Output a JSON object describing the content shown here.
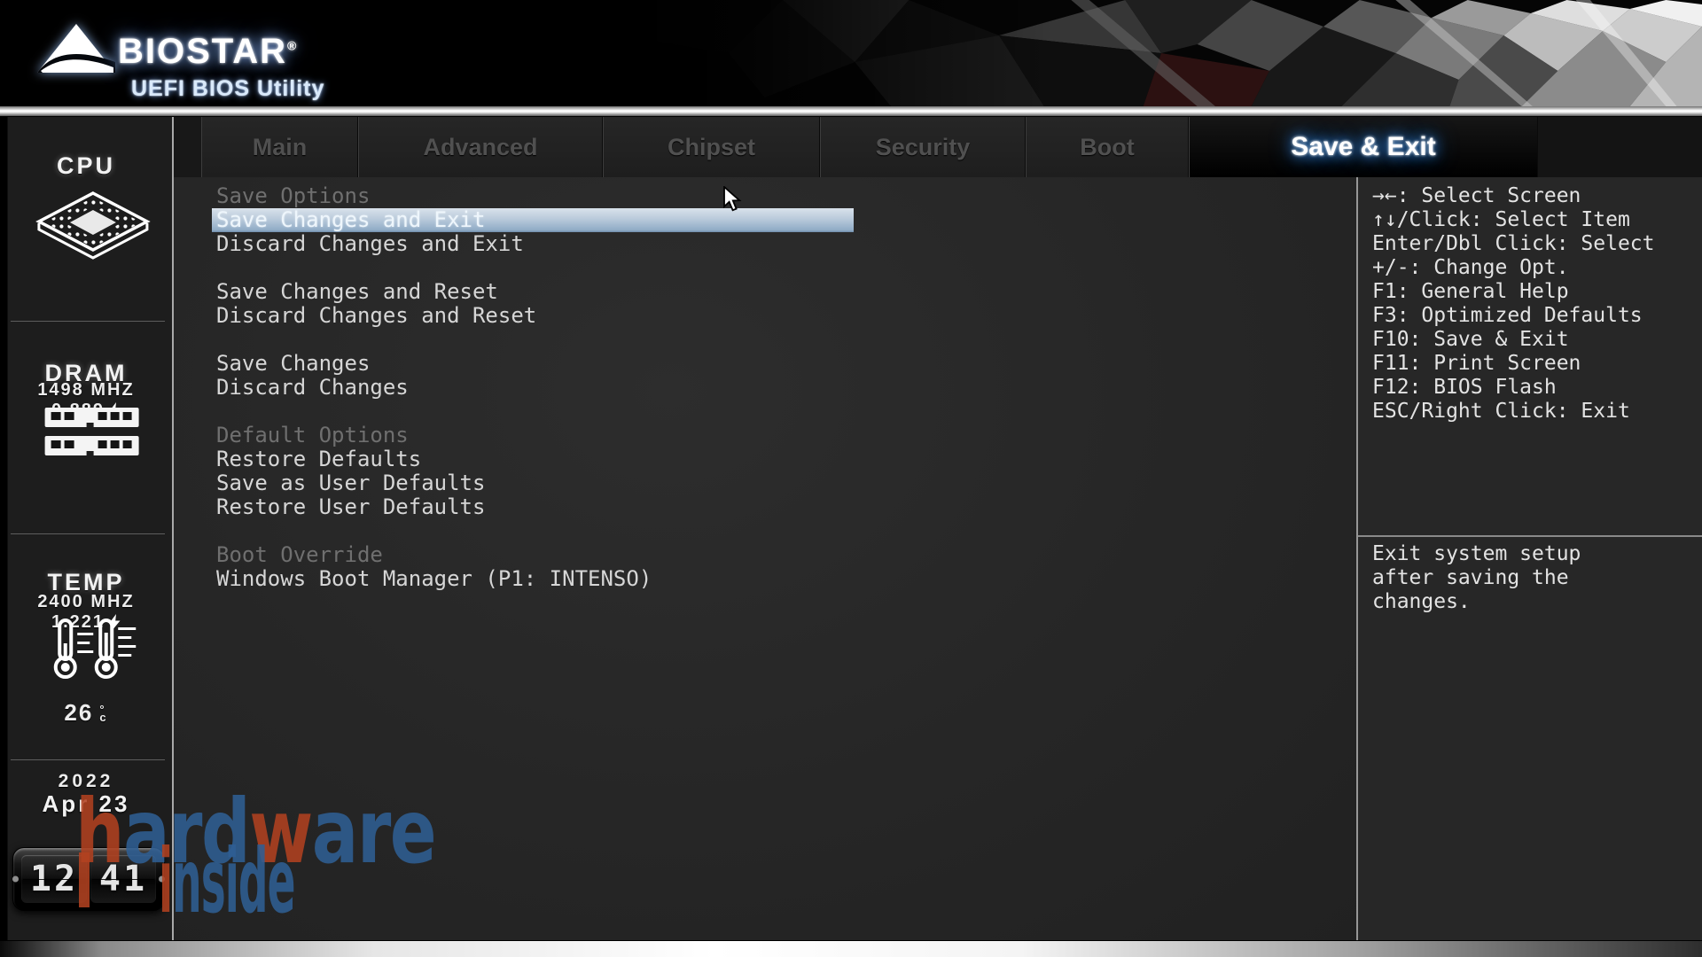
{
  "header": {
    "brand": "BIOSTAR",
    "brand_reg": "®",
    "subtitle": "UEFI BIOS Utility"
  },
  "tabs": [
    {
      "label": "Main",
      "active": false
    },
    {
      "label": "Advanced",
      "active": false
    },
    {
      "label": "Chipset",
      "active": false
    },
    {
      "label": "Security",
      "active": false
    },
    {
      "label": "Boot",
      "active": false
    },
    {
      "label": "Save & Exit",
      "active": true
    }
  ],
  "sidebar": {
    "cpu": {
      "title": "CPU",
      "frequency": "1498 MHZ",
      "voltage": "0.889"
    },
    "dram": {
      "title": "DRAM",
      "frequency": "2400 MHZ",
      "voltage": "1.221"
    },
    "temp": {
      "title": "TEMP",
      "value": "26",
      "degree": "°",
      "unit": "c"
    },
    "datetime": {
      "year": "2022",
      "date": "Apr 23",
      "hours": "12",
      "minutes": "41"
    }
  },
  "menu": {
    "rows": [
      {
        "type": "header",
        "text": "Save Options"
      },
      {
        "type": "item",
        "text": "Save Changes and Exit",
        "selected": true
      },
      {
        "type": "item",
        "text": "Discard Changes and Exit"
      },
      {
        "type": "gap"
      },
      {
        "type": "item",
        "text": "Save Changes and Reset"
      },
      {
        "type": "item",
        "text": "Discard Changes and Reset"
      },
      {
        "type": "gap"
      },
      {
        "type": "item",
        "text": "Save Changes"
      },
      {
        "type": "item",
        "text": "Discard Changes"
      },
      {
        "type": "gap"
      },
      {
        "type": "header",
        "text": "Default Options"
      },
      {
        "type": "item",
        "text": "Restore Defaults"
      },
      {
        "type": "item",
        "text": "Save as User Defaults"
      },
      {
        "type": "item",
        "text": "Restore User Defaults"
      },
      {
        "type": "gap"
      },
      {
        "type": "header",
        "text": "Boot Override"
      },
      {
        "type": "item",
        "text": "Windows Boot Manager (P1: INTENSO)"
      }
    ]
  },
  "help": {
    "keys": [
      "→←: Select Screen",
      "↑↓/Click: Select Item",
      "Enter/Dbl Click: Select",
      "+/-: Change Opt.",
      "F1: General Help",
      "F3: Optimized Defaults",
      "F10: Save & Exit",
      "F11: Print Screen",
      "F12: BIOS Flash",
      "ESC/Right Click: Exit"
    ],
    "description_lines": [
      "Exit system setup",
      "after saving the",
      "changes."
    ]
  },
  "watermark": {
    "line1": [
      {
        "text": "h",
        "color": "orange"
      },
      {
        "text": "ard",
        "color": "blue"
      },
      {
        "text": "w",
        "color": "orange"
      },
      {
        "text": "are",
        "color": "blue"
      }
    ],
    "line2": [
      {
        "text": "i",
        "color": "orange"
      },
      {
        "text": "nside",
        "color": "blue"
      }
    ]
  },
  "colors": {
    "selected_row": "#9fb8d2",
    "active_tab_glow": "#3d9bff",
    "watermark_blue": "#2f5f94",
    "watermark_orange": "#b24120"
  }
}
